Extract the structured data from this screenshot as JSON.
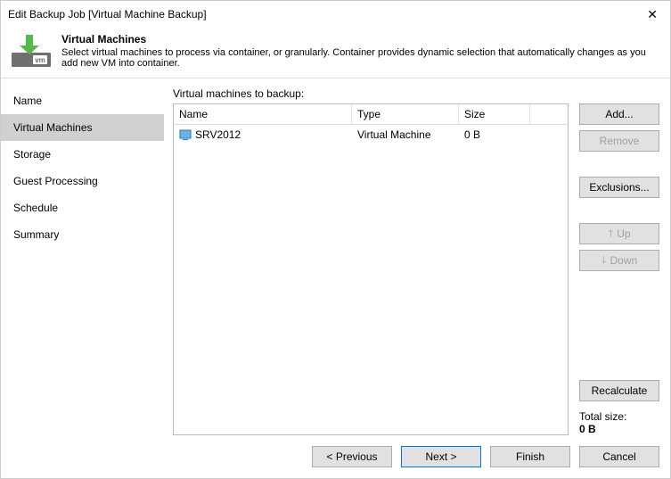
{
  "window": {
    "title": "Edit Backup Job [Virtual Machine Backup]"
  },
  "header": {
    "heading": "Virtual Machines",
    "description": "Select virtual machines to process via container, or granularly. Container provides dynamic selection that automatically changes as you add new VM into container."
  },
  "sidebar": {
    "items": [
      "Name",
      "Virtual Machines",
      "Storage",
      "Guest Processing",
      "Schedule",
      "Summary"
    ],
    "selectedIndex": 1
  },
  "main": {
    "listLabel": "Virtual machines to backup:",
    "columns": {
      "name": "Name",
      "type": "Type",
      "size": "Size"
    },
    "rows": [
      {
        "name": "SRV2012",
        "type": "Virtual Machine",
        "size": "0 B"
      }
    ],
    "totalLabel": "Total size:",
    "totalValue": "0 B"
  },
  "buttons": {
    "add": "Add...",
    "remove": "Remove",
    "exclusions": "Exclusions...",
    "up": "Up",
    "down": "Down",
    "recalculate": "Recalculate"
  },
  "footer": {
    "previous": "< Previous",
    "next": "Next >",
    "finish": "Finish",
    "cancel": "Cancel"
  }
}
